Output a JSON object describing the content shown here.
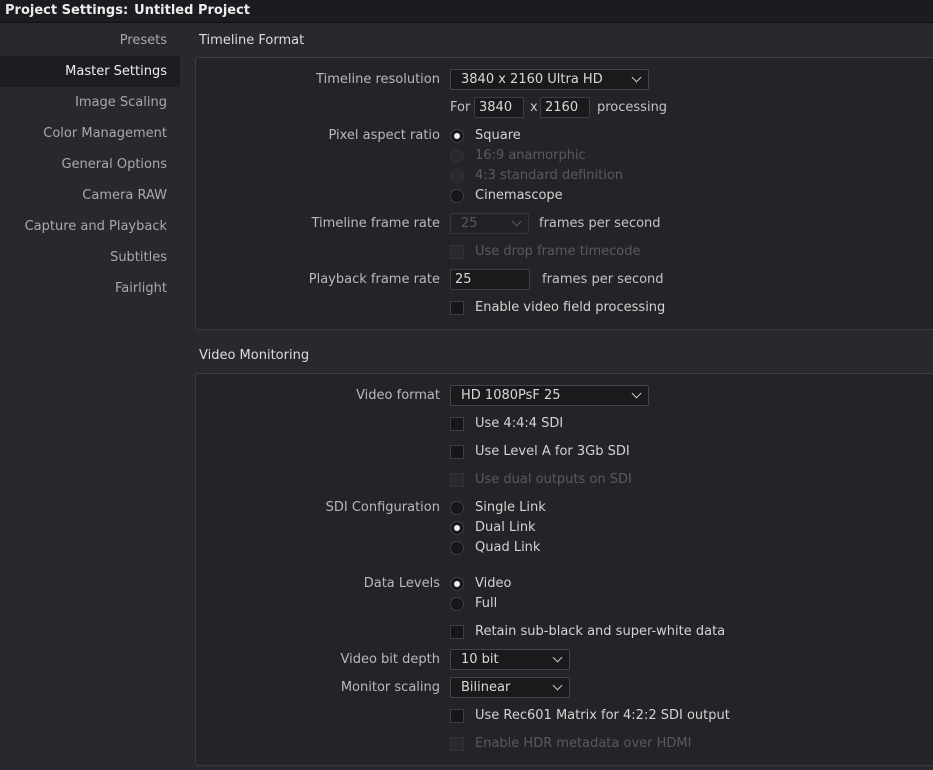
{
  "window": {
    "title_prefix": "Project Settings:",
    "project_name": "Untitled Project"
  },
  "sidebar": {
    "items": [
      {
        "label": "Presets",
        "active": false
      },
      {
        "label": "Master Settings",
        "active": true
      },
      {
        "label": "Image Scaling",
        "active": false
      },
      {
        "label": "Color Management",
        "active": false
      },
      {
        "label": "General Options",
        "active": false
      },
      {
        "label": "Camera RAW",
        "active": false
      },
      {
        "label": "Capture and Playback",
        "active": false
      },
      {
        "label": "Subtitles",
        "active": false
      },
      {
        "label": "Fairlight",
        "active": false
      }
    ]
  },
  "timeline_format": {
    "title": "Timeline Format",
    "resolution_label": "Timeline resolution",
    "resolution_value": "3840 x 2160 Ultra HD",
    "for_label": "For",
    "width_value": "3840",
    "x_label": "x",
    "height_value": "2160",
    "processing_label": "processing",
    "par_label": "Pixel aspect ratio",
    "par_options": [
      {
        "label": "Square",
        "selected": true,
        "enabled": true
      },
      {
        "label": "16:9 anamorphic",
        "selected": false,
        "enabled": false
      },
      {
        "label": "4:3 standard definition",
        "selected": false,
        "enabled": false
      },
      {
        "label": "Cinemascope",
        "selected": false,
        "enabled": true
      }
    ],
    "frame_rate_label": "Timeline frame rate",
    "frame_rate_value": "25",
    "fps_label": "frames per second",
    "drop_frame_label": "Use drop frame timecode",
    "playback_label": "Playback frame rate",
    "playback_value": "25",
    "playback_fps_label": "frames per second",
    "field_processing_label": "Enable video field processing"
  },
  "video_monitoring": {
    "title": "Video Monitoring",
    "format_label": "Video format",
    "format_value": "HD 1080PsF 25",
    "use444_label": "Use 4:4:4 SDI",
    "levela_label": "Use Level A for 3Gb SDI",
    "dual_outputs_label": "Use dual outputs on SDI",
    "sdi_label": "SDI Configuration",
    "sdi_options": [
      {
        "label": "Single Link",
        "selected": false
      },
      {
        "label": "Dual Link",
        "selected": true
      },
      {
        "label": "Quad Link",
        "selected": false
      }
    ],
    "data_levels_label": "Data Levels",
    "data_level_options": [
      {
        "label": "Video",
        "selected": true
      },
      {
        "label": "Full",
        "selected": false
      }
    ],
    "retain_label": "Retain sub-black and super-white data",
    "bit_depth_label": "Video bit depth",
    "bit_depth_value": "10 bit",
    "monitor_scaling_label": "Monitor scaling",
    "monitor_scaling_value": "Bilinear",
    "rec601_label": "Use Rec601 Matrix for 4:2:2 SDI output",
    "hdr_label": "Enable HDR metadata over HDMI"
  }
}
